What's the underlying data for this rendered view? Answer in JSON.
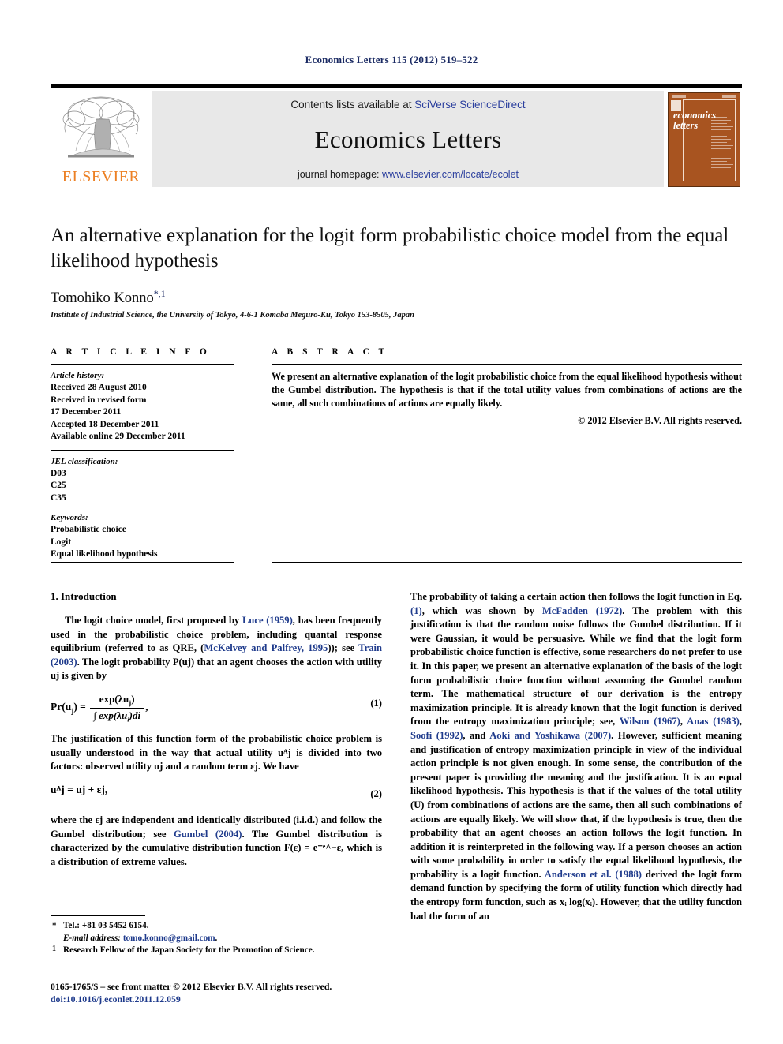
{
  "running_head": "Economics Letters 115 (2012) 519–522",
  "masthead": {
    "contents_prefix": "Contents lists available at ",
    "contents_link": "SciVerse ScienceDirect",
    "journal_name": "Economics Letters",
    "homepage_prefix": "journal homepage: ",
    "homepage_link": "www.elsevier.com/locate/ecolet",
    "publisher": "ELSEVIER",
    "cover_title_line1": "economics",
    "cover_title_line2": "letters",
    "cover_color": "#a85420",
    "link_color": "#2b3f9e"
  },
  "title": "An alternative explanation for the logit form probabilistic choice model from the equal likelihood hypothesis",
  "author": {
    "name": "Tomohiko Konno",
    "marks": "*,1",
    "affiliation": "Institute of Industrial Science, the University of Tokyo, 4-6-1 Komaba Meguro-Ku, Tokyo 153-8505, Japan"
  },
  "article_info": {
    "heading": "A R T I C L E   I N F O",
    "history_label": "Article history:",
    "history": [
      "Received 28 August 2010",
      "Received in revised form",
      "17 December 2011",
      "Accepted 18 December 2011",
      "Available online 29 December 2011"
    ],
    "jel_label": "JEL classification:",
    "jel_codes": [
      "D03",
      "C25",
      "C35"
    ],
    "keywords_label": "Keywords:",
    "keywords": [
      "Probabilistic choice",
      "Logit",
      "Equal likelihood hypothesis"
    ]
  },
  "abstract": {
    "heading": "A B S T R A C T",
    "text": "We present an alternative explanation of the logit probabilistic choice from the equal likelihood hypothesis without the Gumbel distribution. The hypothesis is that if the total utility values from combinations of actions are the same, all such combinations of actions are equally likely.",
    "copyright": "© 2012 Elsevier B.V. All rights reserved."
  },
  "body": {
    "section1_title": "1. Introduction",
    "left": {
      "p1_a": "The logit choice model, first proposed by ",
      "p1_ref1": "Luce (1959)",
      "p1_b": ", has been frequently used in the probabilistic choice problem, including quantal response equilibrium (referred to as QRE, (",
      "p1_ref2": "McKelvey and Palfrey, 1995",
      "p1_c": ")); see ",
      "p1_ref3": "Train (2003)",
      "p1_d": ". The logit probability P(uj) that an agent chooses the action with utility uj is given by",
      "eq1_number": "(1)",
      "eq1_lhs": "Pr(u",
      "eq1_lhs_sub": "j",
      "eq1_lhs_end": ") =",
      "eq1_num": "exp(λu",
      "eq1_num_sub": "j",
      "eq1_num_end": ")",
      "eq1_den": "∫ exp(λu",
      "eq1_den_sub": "i",
      "eq1_den_end": ")di",
      "eq1_tail": ",",
      "p2": "The justification of this function form of the probabilistic choice problem is usually understood in the way that actual utility uᴬj is divided into two factors: observed utility uj and a random term εj. We have",
      "eq2_number": "(2)",
      "eq2_text": "uᴬj = uj + εj,",
      "p3_a": "where the εj are independent and identically distributed (i.i.d.) and follow the Gumbel distribution; see ",
      "p3_ref": "Gumbel (2004)",
      "p3_b": ". The Gumbel distribution is characterized by the cumulative distribution function F(ε) = e⁻ᵉ^−ε, which is a distribution of extreme values."
    },
    "right": {
      "p1_a": "The probability of taking a certain action then follows the logit function in Eq. ",
      "p1_ref1": "(1)",
      "p1_b": ", which was shown by ",
      "p1_ref2": "McFadden (1972)",
      "p1_c": ". The problem with this justification is that the random noise follows the Gumbel distribution. If it were Gaussian, it would be persuasive. While we find that the logit form probabilistic choice function is effective, some researchers do not prefer to use it. In this paper, we present an alternative explanation of the basis of the logit form probabilistic choice function without assuming the Gumbel random term. The mathematical structure of our derivation is the entropy maximization principle. It is already known that the logit function is derived from the entropy maximization principle; see, ",
      "p1_ref3": "Wilson (1967)",
      "p1_d": ", ",
      "p1_ref4": "Anas (1983)",
      "p1_e": ", ",
      "p1_ref5": "Soofi (1992)",
      "p1_f": ", and ",
      "p1_ref6": "Aoki and Yoshikawa (2007)",
      "p1_g": ". However, sufficient meaning and justification of entropy maximization principle in view of the individual action principle is not given enough. In some sense, the contribution of the present paper is providing the meaning and the justification. It is an equal likelihood hypothesis. This hypothesis is that if the values of the total utility (U) from combinations of actions are the same, then all such combinations of actions are equally likely. We will show that, if the hypothesis is true, then the probability that an agent chooses an action follows the logit function. In addition it is reinterpreted in the following way. If a person chooses an action with some probability in order to satisfy the equal likelihood hypothesis, the probability is a logit function. ",
      "p1_ref7": "Anderson et al. (1988)",
      "p1_h": " derived the logit form demand function by specifying the form of utility function which  directly had the entropy form function, such as xᵢ log(xᵢ). However, that the utility function had the form of an"
    }
  },
  "footnotes": {
    "tel_mark": "*",
    "tel": "Tel.: +81 03 5452 6154.",
    "email_label": "E-mail address:",
    "email": "tomo.konno@gmail.com",
    "email_period": ".",
    "fn1_mark": "1",
    "fn1": "Research Fellow of the Japan Society for the Promotion of Science."
  },
  "issn": {
    "line1": "0165-1765/$ – see front matter © 2012 Elsevier B.V. All rights reserved.",
    "line2": "doi:10.1016/j.econlet.2011.12.059"
  }
}
